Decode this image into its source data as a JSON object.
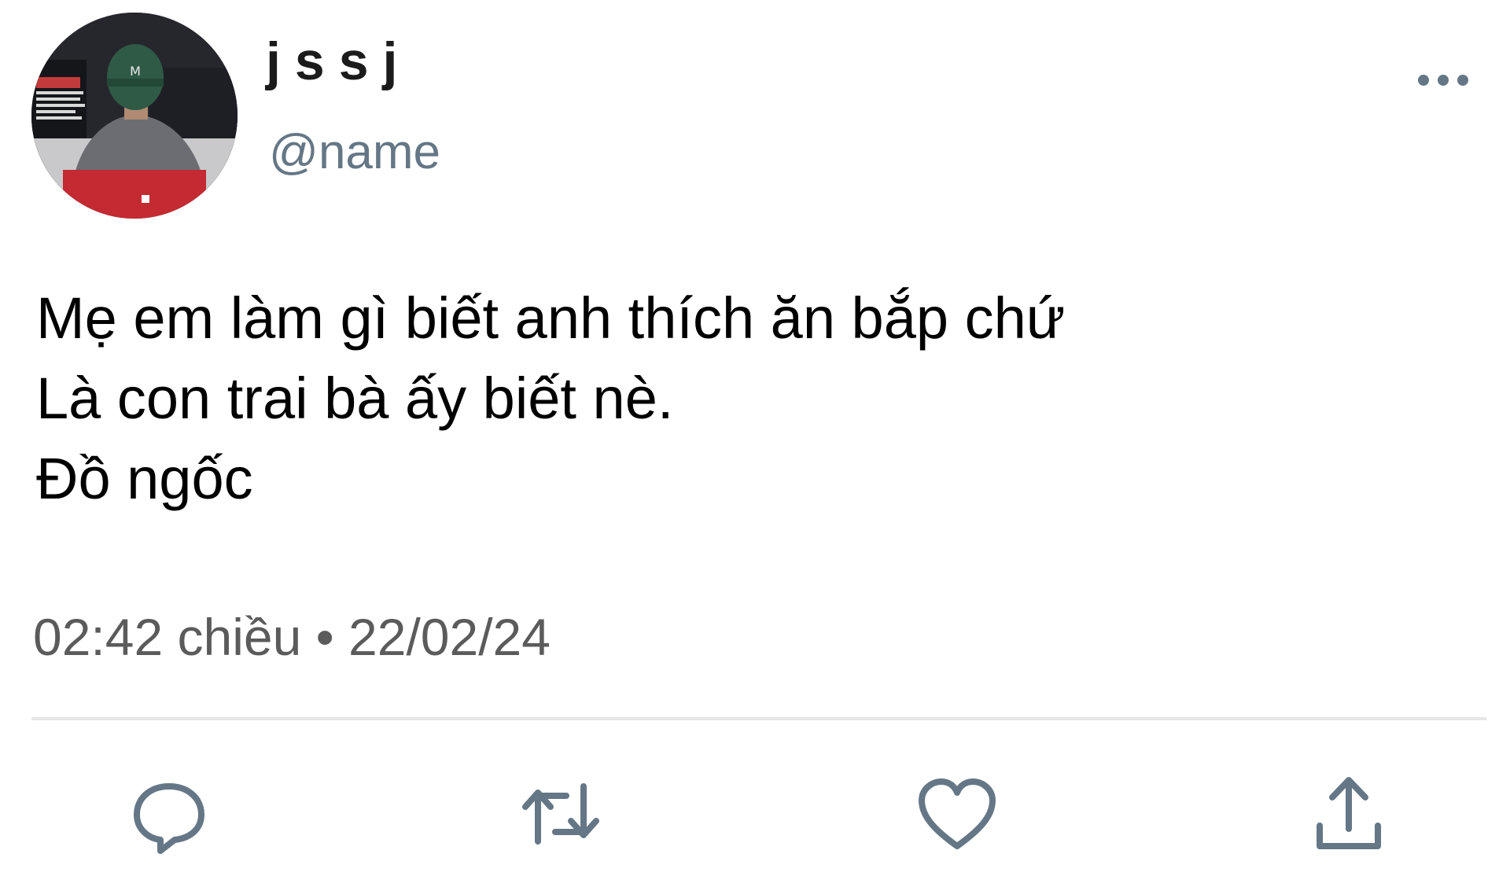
{
  "user": {
    "display_name": "jssj",
    "handle": "@name",
    "avatar_icon": "user-avatar-photo"
  },
  "tweet": {
    "lines": [
      "Mẹ em làm gì biết anh thích ăn bắp chứ",
      "Là con trai bà ấy biết nè.",
      "Đồ ngốc"
    ],
    "timestamp": "02:42 chiều • 22/02/24"
  },
  "actions": {
    "more_icon": "more-options-icon",
    "reply_icon": "reply-icon",
    "retweet_icon": "retweet-icon",
    "like_icon": "like-icon",
    "share_icon": "share-icon"
  },
  "colors": {
    "icon": "#657786",
    "handle": "#657786",
    "timestamp": "#5b5b5b",
    "divider": "#e6e6e6"
  }
}
